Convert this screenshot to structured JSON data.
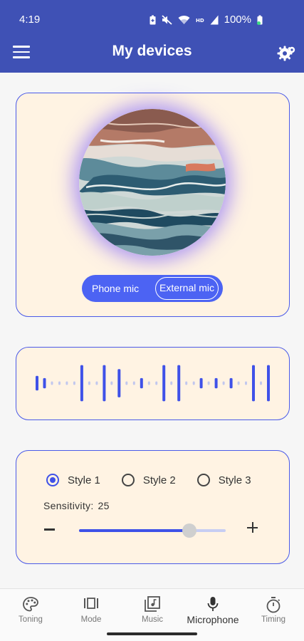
{
  "status_bar": {
    "time": "4:19",
    "battery": "100%",
    "icons": [
      "battery-saver-icon",
      "mute-icon",
      "wifi-icon",
      "hd-icon",
      "signal-icon",
      "battery-icon"
    ]
  },
  "app_bar": {
    "title": "My devices",
    "menu_icon": "hamburger-menu-icon",
    "settings_icon": "gear-settings-icon",
    "color": "#3f51b5"
  },
  "visual_card": {
    "mic_options": [
      "Phone mic",
      "External mic"
    ],
    "selected_mic": "External mic",
    "accent": "#4c63f3"
  },
  "waveform": {
    "bar_levels": [
      0.33,
      0.23,
      0.08,
      0.08,
      0.08,
      0.08,
      0.82,
      0.08,
      0.08,
      0.82,
      0.08,
      0.64,
      0.08,
      0.08,
      0.23,
      0.08,
      0.08,
      0.82,
      0.08,
      0.82,
      0.08,
      0.08,
      0.23,
      0.08,
      0.23,
      0.08,
      0.23,
      0.08,
      0.08,
      0.82,
      0.08,
      0.82
    ]
  },
  "style_card": {
    "styles": [
      "Style 1",
      "Style 2",
      "Style 3"
    ],
    "selected_style": "Style 1",
    "sensitivity_label": "Sensitivity:",
    "sensitivity_value": "25",
    "slider_level": 0.75
  },
  "bottom_nav": {
    "items": [
      {
        "label": "Toning",
        "icon": "palette-icon"
      },
      {
        "label": "Mode",
        "icon": "mode-icon"
      },
      {
        "label": "Music",
        "icon": "music-library-icon"
      },
      {
        "label": "Microphone",
        "icon": "microphone-icon"
      },
      {
        "label": "Timing",
        "icon": "stopwatch-icon"
      }
    ],
    "active": "Microphone"
  }
}
